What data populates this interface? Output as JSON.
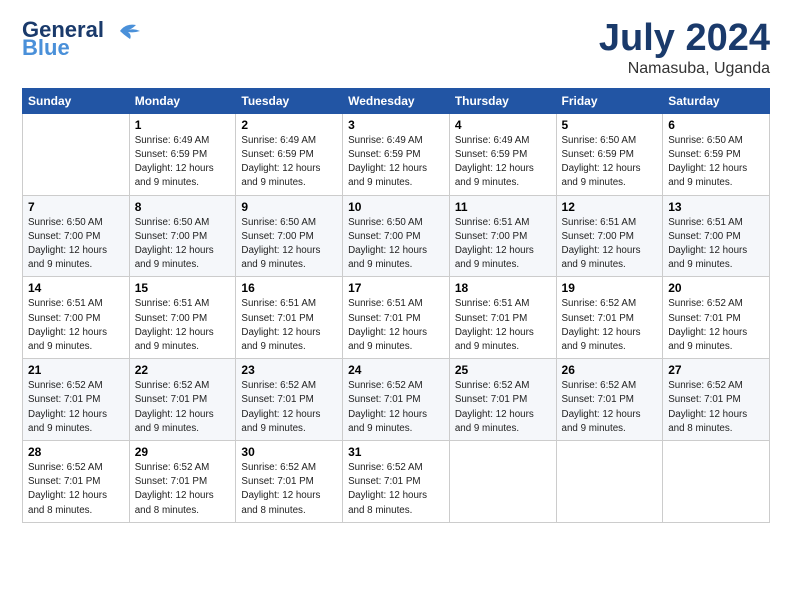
{
  "logo": {
    "line1": "General",
    "line2": "Blue"
  },
  "title": "July 2024",
  "subtitle": "Namasuba, Uganda",
  "days_header": [
    "Sunday",
    "Monday",
    "Tuesday",
    "Wednesday",
    "Thursday",
    "Friday",
    "Saturday"
  ],
  "weeks": [
    [
      {
        "day": "",
        "info": ""
      },
      {
        "day": "1",
        "info": "Sunrise: 6:49 AM\nSunset: 6:59 PM\nDaylight: 12 hours\nand 9 minutes."
      },
      {
        "day": "2",
        "info": "Sunrise: 6:49 AM\nSunset: 6:59 PM\nDaylight: 12 hours\nand 9 minutes."
      },
      {
        "day": "3",
        "info": "Sunrise: 6:49 AM\nSunset: 6:59 PM\nDaylight: 12 hours\nand 9 minutes."
      },
      {
        "day": "4",
        "info": "Sunrise: 6:49 AM\nSunset: 6:59 PM\nDaylight: 12 hours\nand 9 minutes."
      },
      {
        "day": "5",
        "info": "Sunrise: 6:50 AM\nSunset: 6:59 PM\nDaylight: 12 hours\nand 9 minutes."
      },
      {
        "day": "6",
        "info": "Sunrise: 6:50 AM\nSunset: 6:59 PM\nDaylight: 12 hours\nand 9 minutes."
      }
    ],
    [
      {
        "day": "7",
        "info": "Sunrise: 6:50 AM\nSunset: 7:00 PM\nDaylight: 12 hours\nand 9 minutes."
      },
      {
        "day": "8",
        "info": "Sunrise: 6:50 AM\nSunset: 7:00 PM\nDaylight: 12 hours\nand 9 minutes."
      },
      {
        "day": "9",
        "info": "Sunrise: 6:50 AM\nSunset: 7:00 PM\nDaylight: 12 hours\nand 9 minutes."
      },
      {
        "day": "10",
        "info": "Sunrise: 6:50 AM\nSunset: 7:00 PM\nDaylight: 12 hours\nand 9 minutes."
      },
      {
        "day": "11",
        "info": "Sunrise: 6:51 AM\nSunset: 7:00 PM\nDaylight: 12 hours\nand 9 minutes."
      },
      {
        "day": "12",
        "info": "Sunrise: 6:51 AM\nSunset: 7:00 PM\nDaylight: 12 hours\nand 9 minutes."
      },
      {
        "day": "13",
        "info": "Sunrise: 6:51 AM\nSunset: 7:00 PM\nDaylight: 12 hours\nand 9 minutes."
      }
    ],
    [
      {
        "day": "14",
        "info": "Sunrise: 6:51 AM\nSunset: 7:00 PM\nDaylight: 12 hours\nand 9 minutes."
      },
      {
        "day": "15",
        "info": "Sunrise: 6:51 AM\nSunset: 7:00 PM\nDaylight: 12 hours\nand 9 minutes."
      },
      {
        "day": "16",
        "info": "Sunrise: 6:51 AM\nSunset: 7:01 PM\nDaylight: 12 hours\nand 9 minutes."
      },
      {
        "day": "17",
        "info": "Sunrise: 6:51 AM\nSunset: 7:01 PM\nDaylight: 12 hours\nand 9 minutes."
      },
      {
        "day": "18",
        "info": "Sunrise: 6:51 AM\nSunset: 7:01 PM\nDaylight: 12 hours\nand 9 minutes."
      },
      {
        "day": "19",
        "info": "Sunrise: 6:52 AM\nSunset: 7:01 PM\nDaylight: 12 hours\nand 9 minutes."
      },
      {
        "day": "20",
        "info": "Sunrise: 6:52 AM\nSunset: 7:01 PM\nDaylight: 12 hours\nand 9 minutes."
      }
    ],
    [
      {
        "day": "21",
        "info": "Sunrise: 6:52 AM\nSunset: 7:01 PM\nDaylight: 12 hours\nand 9 minutes."
      },
      {
        "day": "22",
        "info": "Sunrise: 6:52 AM\nSunset: 7:01 PM\nDaylight: 12 hours\nand 9 minutes."
      },
      {
        "day": "23",
        "info": "Sunrise: 6:52 AM\nSunset: 7:01 PM\nDaylight: 12 hours\nand 9 minutes."
      },
      {
        "day": "24",
        "info": "Sunrise: 6:52 AM\nSunset: 7:01 PM\nDaylight: 12 hours\nand 9 minutes."
      },
      {
        "day": "25",
        "info": "Sunrise: 6:52 AM\nSunset: 7:01 PM\nDaylight: 12 hours\nand 9 minutes."
      },
      {
        "day": "26",
        "info": "Sunrise: 6:52 AM\nSunset: 7:01 PM\nDaylight: 12 hours\nand 9 minutes."
      },
      {
        "day": "27",
        "info": "Sunrise: 6:52 AM\nSunset: 7:01 PM\nDaylight: 12 hours\nand 8 minutes."
      }
    ],
    [
      {
        "day": "28",
        "info": "Sunrise: 6:52 AM\nSunset: 7:01 PM\nDaylight: 12 hours\nand 8 minutes."
      },
      {
        "day": "29",
        "info": "Sunrise: 6:52 AM\nSunset: 7:01 PM\nDaylight: 12 hours\nand 8 minutes."
      },
      {
        "day": "30",
        "info": "Sunrise: 6:52 AM\nSunset: 7:01 PM\nDaylight: 12 hours\nand 8 minutes."
      },
      {
        "day": "31",
        "info": "Sunrise: 6:52 AM\nSunset: 7:01 PM\nDaylight: 12 hours\nand 8 minutes."
      },
      {
        "day": "",
        "info": ""
      },
      {
        "day": "",
        "info": ""
      },
      {
        "day": "",
        "info": ""
      }
    ]
  ]
}
